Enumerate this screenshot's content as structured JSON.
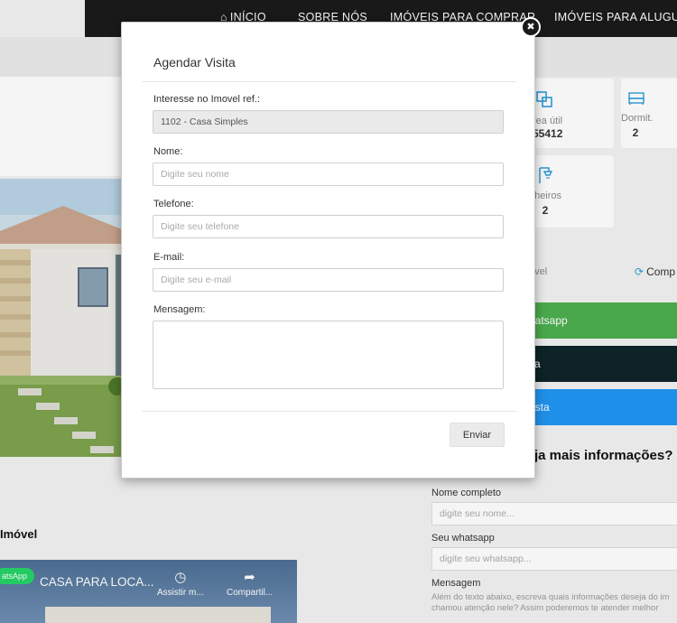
{
  "nav": {
    "home": "INÍCIO",
    "about": "SOBRE NÓS",
    "buy": "IMÓVEIS PARA COMPRAR",
    "rent": "IMÓVEIS PARA ALUGUEL"
  },
  "specs": {
    "area_label": "rea útil",
    "area_value": "55412",
    "dorm_label": "Dormit.",
    "dorm_value": "2",
    "bath_label": "nheiros",
    "bath_value": "2"
  },
  "actions": {
    "favorite_label": "óvel",
    "share_label": "Comp"
  },
  "cta": {
    "whatsapp": "hatsapp",
    "visit": "ita",
    "proposal": "osta"
  },
  "info_form": {
    "title": "ja mais informações?",
    "name_label": "Nome completo",
    "name_placeholder": "digite seu nome...",
    "whatsapp_label": "Seu whatsapp",
    "whatsapp_placeholder": "digite seu whatsapp...",
    "message_label": "Mensagem",
    "message_hint_1": "Além do texto abaixo, escreva quais informações deseja do im",
    "message_hint_2": "chamou atenção nele? Assim poderemos te atender melhor"
  },
  "section": {
    "title": "Imóvel"
  },
  "video": {
    "badge": "atsApp",
    "title": "CASA PARA LOCA...",
    "watch": "Assistir m...",
    "share": "Compartil..."
  },
  "modal": {
    "title": "Agendar Visita",
    "ref_label": "Interesse no Imovel ref.:",
    "ref_value": "1102 - Casa Simples",
    "name_label": "Nome:",
    "name_placeholder": "Digite seu nome",
    "phone_label": "Telefone:",
    "phone_placeholder": "Digite seu telefone",
    "email_label": "E-mail:",
    "email_placeholder": "Digite seu e-mail",
    "message_label": "Mensagem:",
    "send_label": "Enviar",
    "close_glyph": "✖"
  },
  "icons": {
    "home": "home-icon",
    "area": "area-icon",
    "bed": "bed-icon",
    "shower": "shower-icon",
    "share": "share-icon",
    "clock": "clock-icon",
    "forward": "forward-icon"
  },
  "colors": {
    "whatsapp_green": "#4caf50",
    "visit_dark": "#0f2529",
    "proposal_blue": "#2196f3",
    "icon_blue": "#2d9cdb",
    "nav_bg": "#1b1b1b"
  }
}
